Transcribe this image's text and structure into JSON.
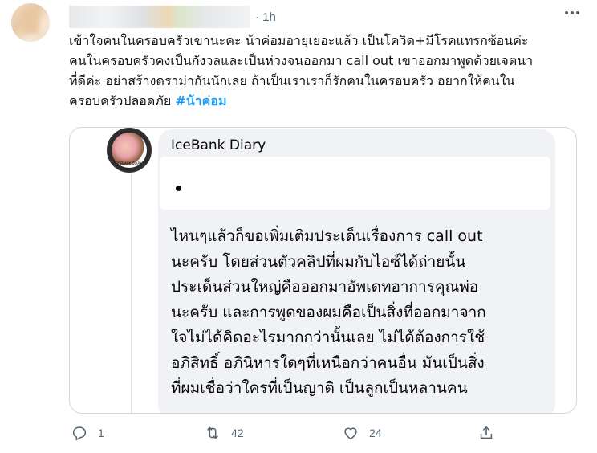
{
  "tweet": {
    "time": "1h",
    "text_lines": [
      "เข้าใจคนในครอบครัวเขานะคะ น้าค่อมอายุเยอะแล้ว เป็นโควิด+มีโรคแทรกซ้อนค่ะ",
      "คนในครอบครัวคงเป็นกังวลและเป็นห่วงจนออกมา call out เขาออกมาพูดด้วยเจตนา",
      "ที่ดีค่ะ อย่าสร้างดราม่ากันนักเลย ถ้าเป็นเราเราก็รักคนในครอบครัว อยากให้คนใน",
      "ครอบครัวปลอดภัย"
    ],
    "hashtag": "#น้าค่อม"
  },
  "embed": {
    "page_name": "IceBank Diary",
    "avatar_caption": "ICEBANK DIARY",
    "body_lines": [
      "ไหนๆแล้วก็ขอเพิ่มเติมประเด็นเรื่องการ call out",
      "นะครับ โดยส่วนตัวคลิปที่ผมกับไอซ์ได้ถ่ายนั้น",
      "ประเด็นส่วนใหญ่คือออกมาอัพเดทอาการคุณพ่อ",
      "นะครับ และการพูดของผมคือเป็นสิ่งที่ออกมาจาก",
      "ใจไม่ได้คิดอะไรมากกว่านั้นเลย ไม่ได้ต้องการใช้",
      "อภิสิทธิ์ อภินิหารใดๆที่เหนือกว่าคนอื่น มันเป็นสิ่ง",
      "ที่ผมเชื่อว่าใครที่เป็นญาติ เป็นลูกเป็นหลานคน"
    ]
  },
  "actions": {
    "reply_count": "1",
    "retweet_count": "42",
    "like_count": "24"
  },
  "icons": {
    "more": "more-icon",
    "reply": "reply-icon",
    "retweet": "retweet-icon",
    "like": "heart-icon",
    "share": "share-icon"
  },
  "colors": {
    "hashtag": "#1d9bf0",
    "secondary_text": "#536471",
    "border": "#cfd9de"
  }
}
